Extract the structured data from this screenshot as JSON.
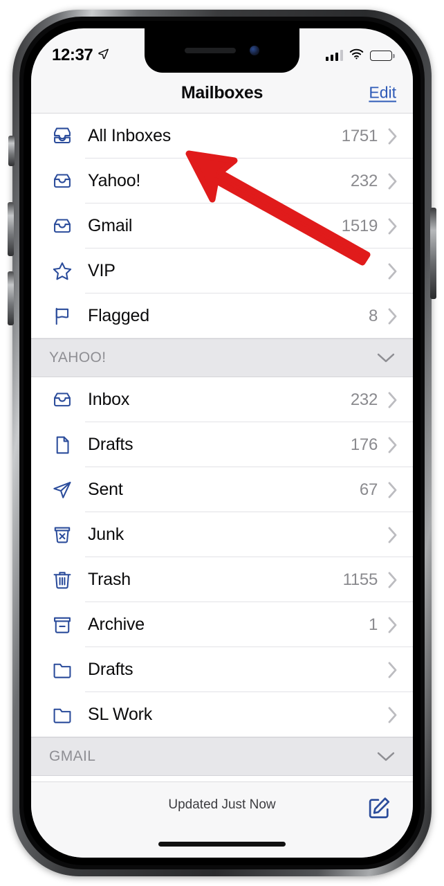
{
  "status_bar": {
    "time": "12:37",
    "location_icon": "location-arrow-icon",
    "signal_icon": "cellular-signal-icon",
    "signal_bars_filled": 3,
    "wifi_icon": "wifi-icon",
    "battery_icon": "battery-low-icon",
    "battery_level_percent": 18,
    "battery_color": "#e8a33d"
  },
  "navbar": {
    "title": "Mailboxes",
    "edit_label": "Edit",
    "edit_color": "#2f5bb7"
  },
  "list": {
    "sections": [
      {
        "id": "favorites",
        "header": null,
        "rows": [
          {
            "icon": "all-inboxes-icon",
            "label": "All Inboxes",
            "count": "1751"
          },
          {
            "icon": "inbox-tray-icon",
            "label": "Yahoo!",
            "count": "232"
          },
          {
            "icon": "inbox-tray-icon",
            "label": "Gmail",
            "count": "1519"
          },
          {
            "icon": "star-icon",
            "label": "VIP",
            "count": ""
          },
          {
            "icon": "flag-icon",
            "label": "Flagged",
            "count": "8"
          }
        ]
      },
      {
        "id": "yahoo",
        "header": {
          "label": "YAHOO!",
          "chevron": "chevron-down-icon"
        },
        "rows": [
          {
            "icon": "inbox-tray-icon",
            "label": "Inbox",
            "count": "232"
          },
          {
            "icon": "drafts-doc-icon",
            "label": "Drafts",
            "count": "176"
          },
          {
            "icon": "sent-plane-icon",
            "label": "Sent",
            "count": "67"
          },
          {
            "icon": "junk-icon",
            "label": "Junk",
            "count": ""
          },
          {
            "icon": "trash-icon",
            "label": "Trash",
            "count": "1155"
          },
          {
            "icon": "archive-icon",
            "label": "Archive",
            "count": "1"
          },
          {
            "icon": "folder-icon",
            "label": "Drafts",
            "count": ""
          },
          {
            "icon": "folder-icon",
            "label": "SL Work",
            "count": ""
          }
        ]
      },
      {
        "id": "gmail",
        "header": {
          "label": "GMAIL",
          "chevron": "chevron-down-icon"
        },
        "rows": []
      }
    ]
  },
  "toolbar": {
    "status_text": "Updated Just Now",
    "compose_icon": "compose-icon"
  },
  "annotation": {
    "arrow_color": "#e01b1b",
    "points_to": "All Inboxes"
  }
}
